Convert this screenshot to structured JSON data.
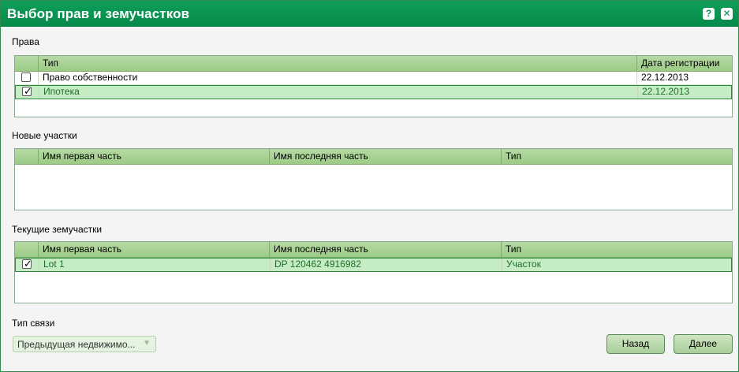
{
  "window": {
    "title": "Выбор прав и земучастков",
    "help": "?",
    "close": "✕"
  },
  "rights": {
    "label": "Права",
    "columns": [
      "Тип",
      "Дата регистрации"
    ],
    "rows": [
      {
        "checked": false,
        "type": "Право собственности",
        "date": "22.12.2013",
        "selected": false
      },
      {
        "checked": true,
        "type": "Ипотека",
        "date": "22.12.2013",
        "selected": true
      }
    ]
  },
  "new_parcels": {
    "label": "Новые участки",
    "columns": [
      "Имя первая часть",
      "Имя последняя часть",
      "Тип"
    ]
  },
  "current_parcels": {
    "label": "Текущие земучастки",
    "columns": [
      "Имя первая часть",
      "Имя последняя часть",
      "Тип"
    ],
    "rows": [
      {
        "checked": true,
        "first": "Lot 1",
        "last": "DP 120462 4916982",
        "type": "Участок",
        "selected": true
      }
    ]
  },
  "link_type": {
    "label": "Тип связи",
    "value": "Предыдущая недвижимо...",
    "arrow": "▼"
  },
  "buttons": {
    "back": "Назад",
    "next": "Далее"
  },
  "colors": {
    "titlebar": "#0b9452",
    "header": "#a6d290",
    "selected_row": "#c5ecc4"
  }
}
